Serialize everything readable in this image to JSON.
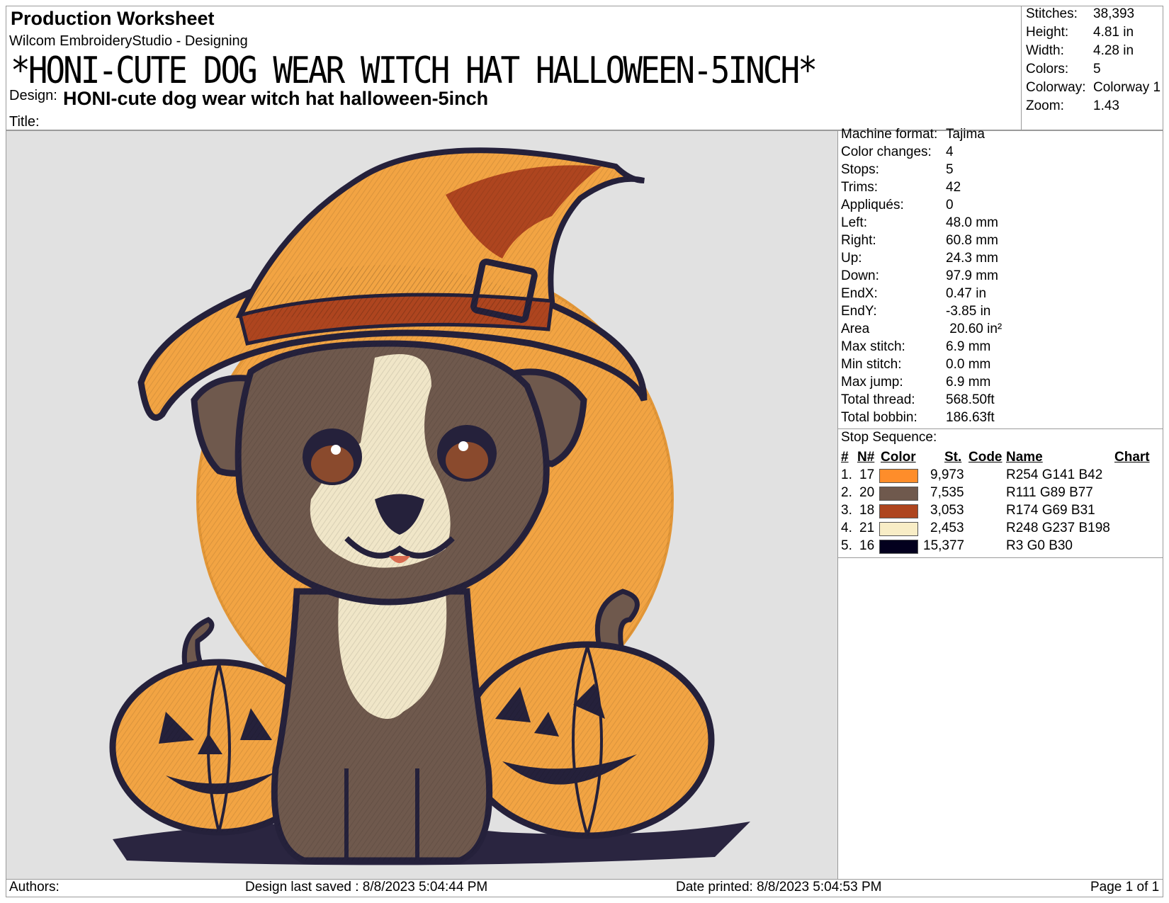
{
  "header": {
    "title": "Production Worksheet",
    "software": "Wilcom EmbroideryStudio - Designing",
    "design_name_big": "*HONI-CUTE DOG WEAR WITCH HAT HALLOWEEN-5INCH*",
    "design_label": "Design:",
    "design_value": "HONI-cute dog wear witch hat halloween-5inch",
    "title_label": "Title:"
  },
  "summary": [
    {
      "label": "Stitches:",
      "value": "38,393"
    },
    {
      "label": "Height:",
      "value": "4.81 in"
    },
    {
      "label": "Width:",
      "value": "4.28 in"
    },
    {
      "label": "Colors:",
      "value": "5"
    },
    {
      "label": "Colorway:",
      "value": "Colorway 1"
    },
    {
      "label": "Zoom:",
      "value": "1.43"
    }
  ],
  "machine_info": [
    {
      "label": "Machine format:",
      "value": "Tajima"
    },
    {
      "label": "Color changes:",
      "value": "4"
    },
    {
      "label": "Stops:",
      "value": "5"
    },
    {
      "label": "Trims:",
      "value": "42"
    },
    {
      "label": "Appliqués:",
      "value": "0"
    },
    {
      "label": "Left:",
      "value": "48.0 mm"
    },
    {
      "label": "Right:",
      "value": "60.8 mm"
    },
    {
      "label": "Up:",
      "value": "24.3 mm"
    },
    {
      "label": "Down:",
      "value": "97.9 mm"
    },
    {
      "label": "EndX:",
      "value": "0.47 in"
    },
    {
      "label": "EndY:",
      "value": "-3.85 in"
    },
    {
      "label": "Area",
      "value": " 20.60 in²"
    },
    {
      "label": "Max stitch:",
      "value": "6.9 mm"
    },
    {
      "label": "Min stitch:",
      "value": "0.0 mm"
    },
    {
      "label": "Max jump:",
      "value": "6.9 mm"
    },
    {
      "label": "Total thread:",
      "value": "568.50ft"
    },
    {
      "label": "Total bobbin:",
      "value": "186.63ft"
    }
  ],
  "stop_sequence": {
    "title": "Stop Sequence:",
    "headers": {
      "num": "#",
      "needle": "N#",
      "color": "Color",
      "stitches": "St.",
      "code": "Code",
      "name": "Name",
      "chart": "Chart"
    },
    "rows": [
      {
        "num": "1.",
        "needle": "17",
        "color": "#fe8d2a",
        "stitches": "9,973",
        "name": "R254 G141 B42"
      },
      {
        "num": "2.",
        "needle": "20",
        "color": "#6f594d",
        "stitches": "7,535",
        "name": "R111 G89 B77"
      },
      {
        "num": "3.",
        "needle": "18",
        "color": "#ae451f",
        "stitches": "3,053",
        "name": "R174 G69 B31"
      },
      {
        "num": "4.",
        "needle": "21",
        "color": "#f8edc6",
        "stitches": "2,453",
        "name": "R248 G237 B198"
      },
      {
        "num": "5.",
        "needle": "16",
        "color": "#03001e",
        "stitches": "15,377",
        "name": "R3 G0 B30"
      }
    ]
  },
  "footer": {
    "authors": "Authors:",
    "last_saved": "Design last saved : 8/8/2023 5:04:44 PM",
    "printed": "Date printed: 8/8/2023 5:04:53 PM",
    "page": "Page 1 of 1"
  }
}
